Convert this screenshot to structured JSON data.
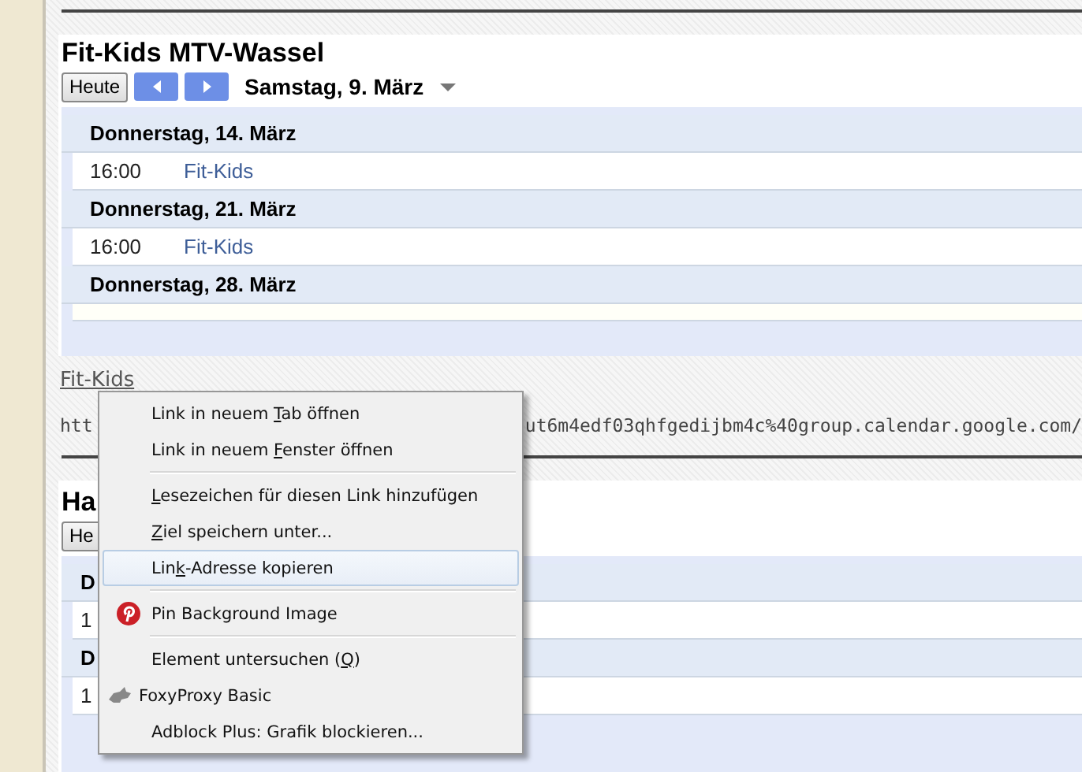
{
  "calendars": [
    {
      "title": "Fit-Kids MTV-Wassel",
      "today_button": "Heute",
      "date_label": "Samstag, 9. März",
      "days": [
        {
          "date": "Donnerstag, 14. März",
          "events": [
            {
              "time": "16:00",
              "title": "Fit-Kids"
            }
          ]
        },
        {
          "date": "Donnerstag, 21. März",
          "events": [
            {
              "time": "16:00",
              "title": "Fit-Kids"
            }
          ]
        },
        {
          "date": "Donnerstag, 28. März"
        }
      ]
    },
    {
      "title": "Ha",
      "today_button": "He",
      "days": [
        {
          "date": "D",
          "events": [
            {
              "time": "1"
            }
          ]
        },
        {
          "date": "D",
          "events": [
            {
              "time": "1"
            }
          ]
        }
      ]
    }
  ],
  "link": {
    "label": "Fit-Kids",
    "url_start": "htt",
    "url_end": "ut6m4edf03qhfgedijbm4c%40group.calendar.google.com/"
  },
  "context_menu": [
    {
      "kind": "item",
      "selected": false,
      "label_start": "Link in neuem ",
      "access_key": "T",
      "label_end": "ab öffnen"
    },
    {
      "kind": "item",
      "selected": false,
      "label_start": "Link in neuem ",
      "access_key": "F",
      "label_end": "enster öffnen"
    },
    {
      "kind": "separator"
    },
    {
      "kind": "item",
      "selected": false,
      "access_key": "L",
      "label_end": "esezeichen für diesen Link hinzufügen"
    },
    {
      "kind": "item",
      "selected": false,
      "access_key": "Z",
      "label_end": "iel speichern unter..."
    },
    {
      "kind": "item",
      "selected": true,
      "label_start": "Lin",
      "access_key": "k",
      "label_end": "-Adresse kopieren"
    },
    {
      "kind": "separator"
    },
    {
      "kind": "pin",
      "selected": false,
      "label_start": "Pin Background Image"
    },
    {
      "kind": "separator"
    },
    {
      "kind": "item",
      "selected": false,
      "label_start": "Element untersuchen (",
      "access_key": "Q",
      "label_end": ")"
    },
    {
      "kind": "addon",
      "selected": false,
      "label_start": "FoxyProxy Basic"
    },
    {
      "kind": "item",
      "selected": false,
      "label_start": "Adblock Plus: Grafik blockieren..."
    }
  ]
}
